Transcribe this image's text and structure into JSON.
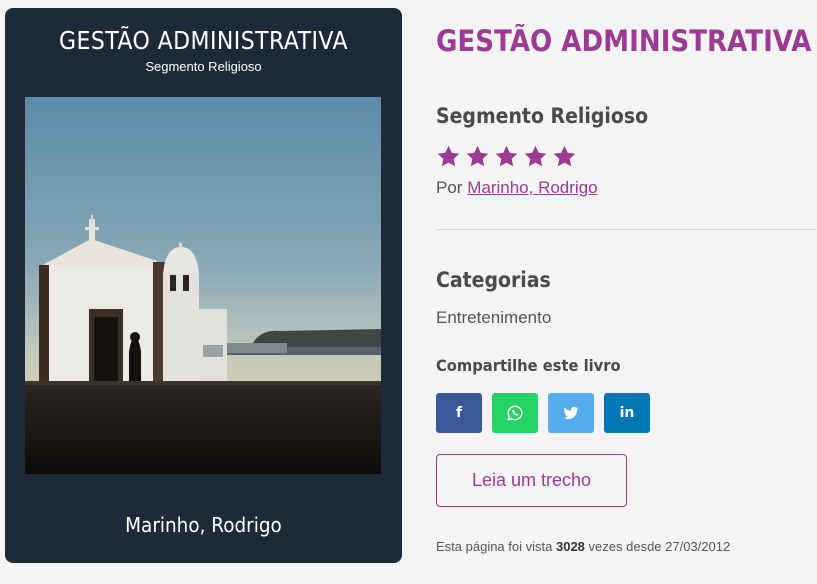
{
  "cover": {
    "title": "GESTÃO ADMINISTRATIVA",
    "subtitle": "Segmento Religioso",
    "author": "Marinho, Rodrigo",
    "background_color": "#1f2a38"
  },
  "book": {
    "title": "GESTÃO ADMINISTRATIVA",
    "subtitle": "Segmento Religioso",
    "rating": 5,
    "rating_max": 5,
    "byline_prefix": "Por",
    "author": "Marinho, Rodrigo",
    "accent_color": "#9b3b93"
  },
  "categories": {
    "heading": "Categorias",
    "value": "Entretenimento"
  },
  "share": {
    "heading": "Compartilhe este livro",
    "buttons": [
      {
        "icon": "facebook-icon",
        "label": "f",
        "color": "#3b5998"
      },
      {
        "icon": "whatsapp-icon",
        "color": "#25d366"
      },
      {
        "icon": "twitter-icon",
        "color": "#55acee"
      },
      {
        "icon": "linkedin-icon",
        "label": "in",
        "color": "#0077b5"
      }
    ]
  },
  "excerpt_button": {
    "label": "Leia um trecho"
  },
  "views": {
    "prefix": "Esta página foi vista",
    "count": "3028",
    "suffix": "vezes desde 27/03/2012"
  }
}
